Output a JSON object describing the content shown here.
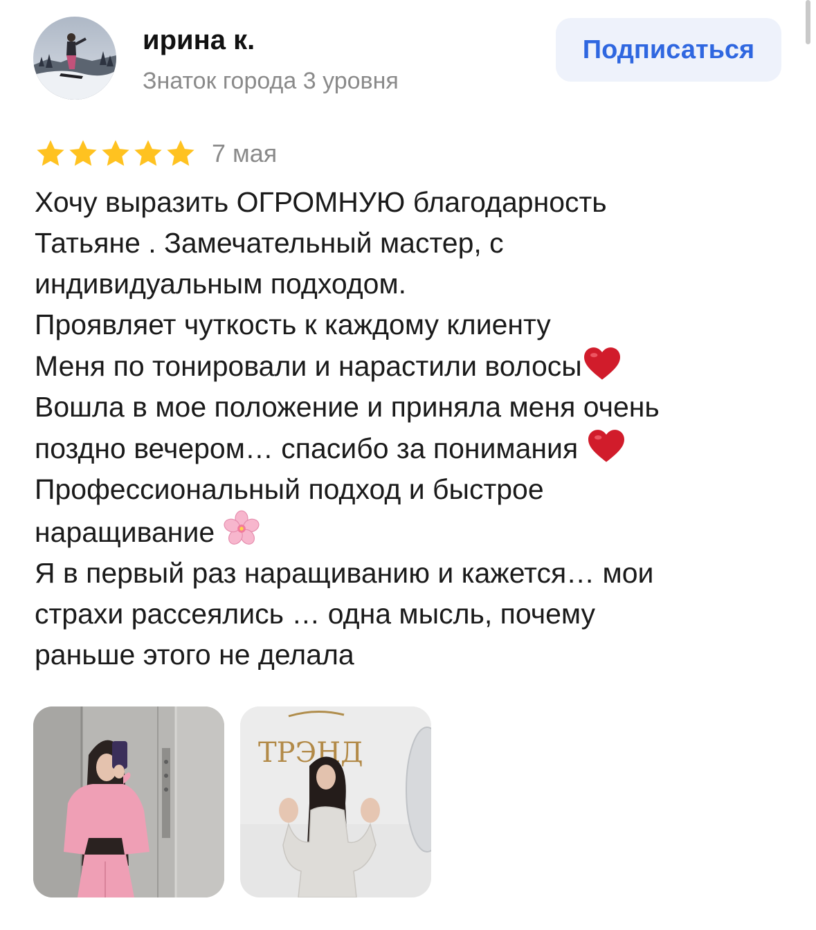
{
  "author": {
    "name": "ирина к.",
    "level": "Знаток города 3 уровня",
    "avatar_icon": "avatar-snowboarder-photo"
  },
  "subscribe": {
    "label": "Подписаться"
  },
  "review": {
    "rating": 5,
    "rating_max": 5,
    "date": "7 мая",
    "lines": [
      "Хочу выразить ОГРОМНУЮ благодарность",
      "Татьяне . Замечательный мастер, с",
      "индивидуальным подходом.",
      "Проявляет чуткость к каждому клиенту",
      "Меня по тонировали  и нарастили волосы",
      "Вошла в мое положение и приняла меня очень",
      "поздно вечером… спасибо за понимания ",
      "Профессиональный подход и быстрое",
      "наращивание ",
      "Я в первый раз наращиванию и кажется… мои",
      "страхи рассеялись … одна мысль, почему",
      "раньше этого не делала"
    ],
    "emojis": {
      "line_5": "red-heart-icon",
      "line_7": "red-heart-icon",
      "line_9": "cherry-blossom-icon"
    }
  },
  "photos": [
    {
      "icon": "photo-elevator-selfie"
    },
    {
      "icon": "photo-salon-trend"
    }
  ],
  "photo_sign_text": "ТРЭНД",
  "colors": {
    "star": "#FFC220",
    "subscribe_bg": "#EEF2FB",
    "subscribe_text": "#2F67E0",
    "muted_text": "#8A8A8A",
    "heart": "#D11C2B"
  }
}
